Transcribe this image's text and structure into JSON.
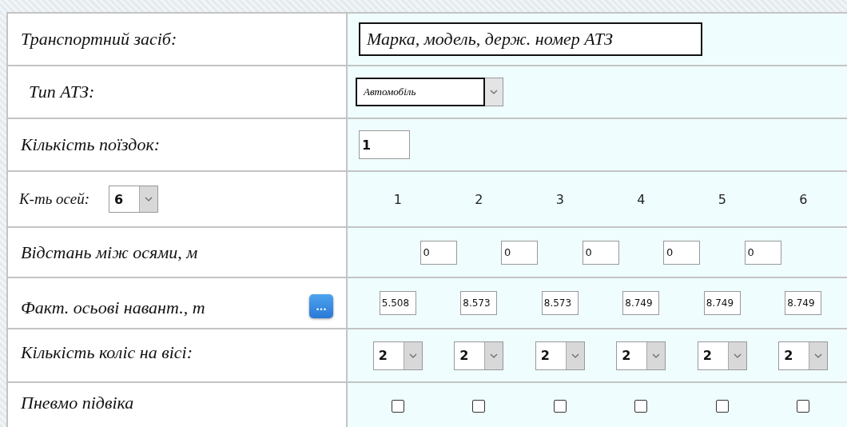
{
  "vehicle": {
    "label": "Транспортний засіб:",
    "value": "Марка, модель, держ. номер АТЗ"
  },
  "type": {
    "label": "Тип АТЗ:",
    "value": "Автомобіль"
  },
  "trips": {
    "label": "Кількість поїздок:",
    "value": "1"
  },
  "axles": {
    "label": "К-ть осей:",
    "value": "6",
    "headers": [
      "1",
      "2",
      "3",
      "4",
      "5",
      "6"
    ]
  },
  "distances": {
    "label": "Відстань між осями, м",
    "values": [
      "0",
      "0",
      "0",
      "0",
      "0"
    ]
  },
  "loads": {
    "label": "Факт. осьові навант., т",
    "button": "...",
    "values": [
      "5.508",
      "8.573",
      "8.573",
      "8.749",
      "8.749",
      "8.749"
    ]
  },
  "wheels": {
    "label": "Кількість коліс на вісі:",
    "values": [
      "2",
      "2",
      "2",
      "2",
      "2",
      "2"
    ]
  },
  "suspension": {
    "label": "Пневмо підвіка",
    "checks": [
      {
        "checked": false
      },
      {
        "checked": false
      },
      {
        "checked": false
      },
      {
        "checked": false
      },
      {
        "checked": false
      },
      {
        "checked": false
      }
    ]
  }
}
